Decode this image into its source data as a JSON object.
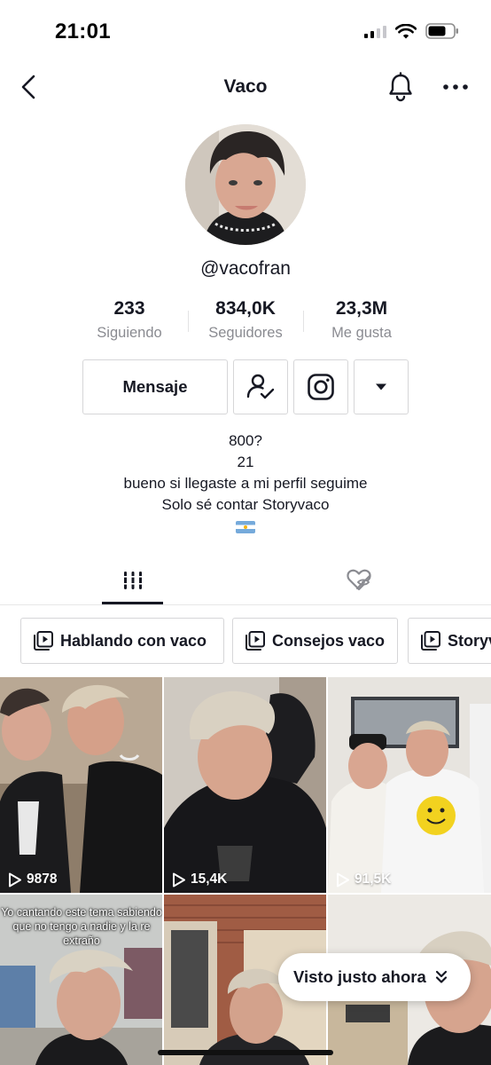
{
  "status": {
    "time": "21:01"
  },
  "header": {
    "title": "Vaco"
  },
  "profile": {
    "username": "@vacofran",
    "stats": [
      {
        "value": "233",
        "label": "Siguiendo"
      },
      {
        "value": "834,0K",
        "label": "Seguidores"
      },
      {
        "value": "23,3M",
        "label": "Me gusta"
      }
    ]
  },
  "actions": {
    "message_label": "Mensaje"
  },
  "bio": {
    "lines": [
      "800?",
      "21",
      "bueno si llegaste a mi perfil seguime",
      "Solo sé contar Storyvaco"
    ],
    "flag_icon": "argentina-flag-icon"
  },
  "tabs": [
    {
      "name": "videos",
      "icon": "grid-icon",
      "active": true
    },
    {
      "name": "liked",
      "icon": "hidden-heart-icon",
      "active": false
    }
  ],
  "playlists": [
    {
      "label": "Hablando con vaco"
    },
    {
      "label": "Consejos vaco"
    },
    {
      "label": "Storyv"
    }
  ],
  "videos": [
    {
      "views": "9878"
    },
    {
      "views": "15,4K"
    },
    {
      "views": "91,5K"
    },
    {
      "views": "",
      "caption": "Yo cantando este tema sabiendo que no tengo a nadie y la re extraño"
    },
    {
      "views": ""
    },
    {
      "views": ""
    }
  ],
  "toast": {
    "label": "Visto justo ahora"
  },
  "colors": {
    "text": "#161823",
    "secondary": "#8a8b91",
    "border": "#d6d6d8"
  }
}
